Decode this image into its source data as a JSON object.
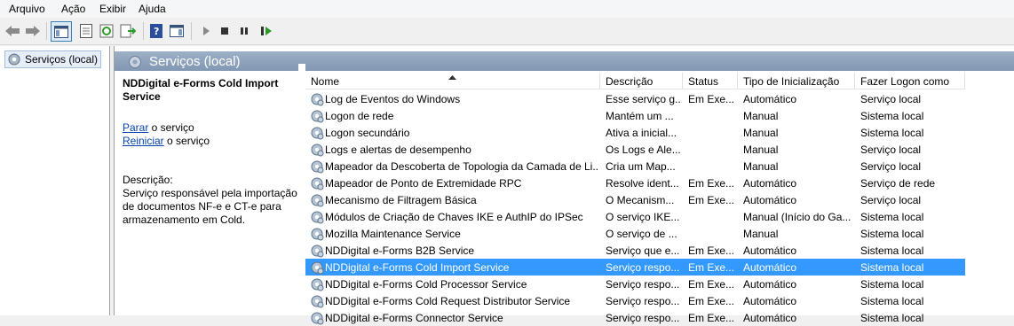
{
  "menu": [
    "Arquivo",
    "Ação",
    "Exibir",
    "Ajuda"
  ],
  "toolbar": {
    "icons": [
      "back-arrow-icon",
      "forward-arrow-icon",
      "show-hide-console-tree-icon",
      "properties-icon",
      "refresh-icon",
      "export-list-icon",
      "help-icon",
      "show-hide-action-pane-icon",
      "start-service-icon",
      "stop-service-icon",
      "pause-service-icon",
      "restart-service-icon"
    ]
  },
  "tree": {
    "root_label": "Serviços (local)"
  },
  "pane": {
    "header_title": "Serviços (local)",
    "service_title": "NDDigital e-Forms Cold Import Service",
    "stop_link": "Parar",
    "stop_suffix": " o serviço",
    "restart_link": "Reiniciar",
    "restart_suffix": " o serviço",
    "description_label": "Descrição:",
    "description_text": "Serviço responsável pela importação de documentos NF-e e CT-e para armazenamento em Cold."
  },
  "table": {
    "columns": [
      "Nome",
      "Descrição",
      "Status",
      "Tipo de Inicialização",
      "Fazer Logon como"
    ],
    "rows": [
      {
        "name": "Log de Eventos do Windows",
        "desc": "Esse serviço g...",
        "status": "Em Exe...",
        "startup": "Automático",
        "logon": "Serviço local"
      },
      {
        "name": "Logon de rede",
        "desc": "Mantém um ...",
        "status": "",
        "startup": "Manual",
        "logon": "Sistema local"
      },
      {
        "name": "Logon secundário",
        "desc": "Ativa a inicial...",
        "status": "",
        "startup": "Manual",
        "logon": "Sistema local"
      },
      {
        "name": "Logs e alertas de desempenho",
        "desc": "Os Logs e Ale...",
        "status": "",
        "startup": "Manual",
        "logon": "Serviço local"
      },
      {
        "name": "Mapeador da Descoberta de Topologia da Camada de Li...",
        "desc": "Cria um Map...",
        "status": "",
        "startup": "Manual",
        "logon": "Serviço local"
      },
      {
        "name": "Mapeador de Ponto de Extremidade RPC",
        "desc": "Resolve ident...",
        "status": "Em Exe...",
        "startup": "Automático",
        "logon": "Serviço de rede"
      },
      {
        "name": "Mecanismo de Filtragem Básica",
        "desc": "O Mecanism...",
        "status": "Em Exe...",
        "startup": "Automático",
        "logon": "Serviço local"
      },
      {
        "name": "Módulos de Criação de Chaves IKE e AuthIP do IPSec",
        "desc": "O serviço IKE...",
        "status": "",
        "startup": "Manual (Início do Ga...",
        "logon": "Sistema local"
      },
      {
        "name": "Mozilla Maintenance Service",
        "desc": "O serviço de ...",
        "status": "",
        "startup": "Manual",
        "logon": "Sistema local"
      },
      {
        "name": "NDDigital e-Forms B2B Service",
        "desc": "Serviço que e...",
        "status": "Em Exe...",
        "startup": "Automático",
        "logon": "Sistema local"
      },
      {
        "name": "NDDigital e-Forms Cold Import Service",
        "desc": "Serviço respo...",
        "status": "Em Exe...",
        "startup": "Automático",
        "logon": "Sistema local",
        "selected": true
      },
      {
        "name": "NDDigital e-Forms Cold Processor Service",
        "desc": "Serviço respo...",
        "status": "Em Exe...",
        "startup": "Automático",
        "logon": "Sistema local"
      },
      {
        "name": "NDDigital e-Forms Cold Request Distributor Service",
        "desc": "Serviço respo...",
        "status": "Em Exe...",
        "startup": "Automático",
        "logon": "Sistema local"
      },
      {
        "name": "NDDigital e-Forms Connector Service",
        "desc": "Serviço respo...",
        "status": "Em Exe...",
        "startup": "Automático",
        "logon": "Sistema local"
      }
    ]
  },
  "colors": {
    "selection": "#3399ff",
    "header_band": "#8ea3bd",
    "link": "#0645ad"
  }
}
